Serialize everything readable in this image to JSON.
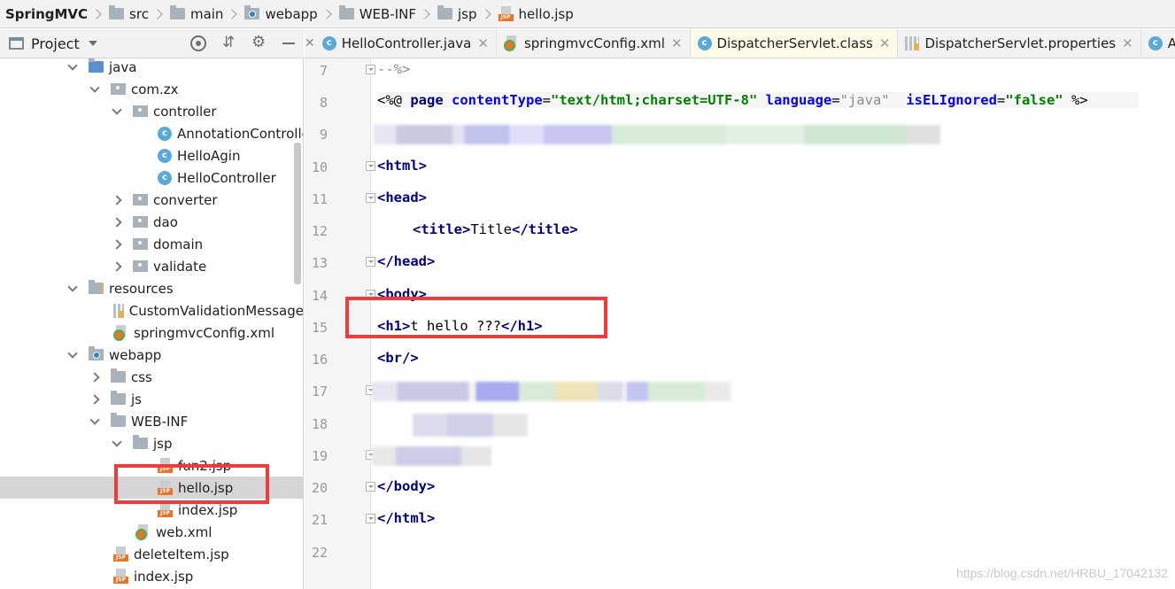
{
  "breadcrumb": [
    "SpringMVC",
    "src",
    "main",
    "webapp",
    "WEB-INF",
    "jsp",
    "hello.jsp"
  ],
  "project_panel": {
    "title": "Project"
  },
  "tree": [
    {
      "label": "java",
      "expanded": true
    },
    {
      "label": "com.zx",
      "expanded": true
    },
    {
      "label": "controller",
      "expanded": true
    },
    {
      "label": "AnnotationControlle"
    },
    {
      "label": "HelloAgin"
    },
    {
      "label": "HelloController"
    },
    {
      "label": "converter",
      "expanded": false
    },
    {
      "label": "dao",
      "expanded": false
    },
    {
      "label": "domain",
      "expanded": false
    },
    {
      "label": "validate",
      "expanded": false
    },
    {
      "label": "resources",
      "expanded": true
    },
    {
      "label": "CustomValidationMessage"
    },
    {
      "label": "springmvcConfig.xml"
    },
    {
      "label": "webapp",
      "expanded": true
    },
    {
      "label": "css",
      "expanded": false
    },
    {
      "label": "js",
      "expanded": false
    },
    {
      "label": "WEB-INF",
      "expanded": true
    },
    {
      "label": "jsp",
      "expanded": true
    },
    {
      "label": "fun2.jsp"
    },
    {
      "label": "hello.jsp",
      "selected": true
    },
    {
      "label": "index.jsp"
    },
    {
      "label": "web.xml"
    },
    {
      "label": "deleteItem.jsp"
    },
    {
      "label": "index.jsp"
    }
  ],
  "tabs": [
    {
      "label": "HelloController.java",
      "icon": "class-icon"
    },
    {
      "label": "springmvcConfig.xml",
      "icon": "xml-icon"
    },
    {
      "label": "DispatcherServlet.class",
      "icon": "class-icon",
      "active": true
    },
    {
      "label": "DispatcherServlet.properties",
      "icon": "properties-icon"
    },
    {
      "label": "An",
      "icon": "class-icon"
    }
  ],
  "line_numbers": [
    "7",
    "8",
    "9",
    "10",
    "11",
    "12",
    "13",
    "14",
    "15",
    "16",
    "17",
    "18",
    "19",
    "20",
    "21",
    "22"
  ],
  "code": {
    "l7": "--%>",
    "l8_a": "<%@ ",
    "l8_b": "page ",
    "l8_c": "contentType",
    "l8_d": "=",
    "l8_e": "\"text/html;charset=UTF-8\"",
    "l8_f": " language",
    "l8_g": "=",
    "l8_h": "\"java\"",
    "l8_i": "  isELIgnored",
    "l8_j": "=",
    "l8_k": "\"false\"",
    "l8_l": " %>",
    "l10": "<html>",
    "l11": "<head>",
    "l12_open": "<title>",
    "l12_text": "Title",
    "l12_close": "</title>",
    "l13": "</head>",
    "l14": "<body>",
    "l15_open": "<h1>",
    "l15_text": "t hello ???",
    "l15_close": "</h1>",
    "l16": "<br/>",
    "l20": "</body>",
    "l21": "</html>"
  },
  "watermark": "https://blog.csdn.net/HRBU_17042132",
  "colors": {
    "highlight_box": "#ee3b3b",
    "tag": "#000080",
    "attribute": "#0000ff",
    "string": "#008000"
  }
}
